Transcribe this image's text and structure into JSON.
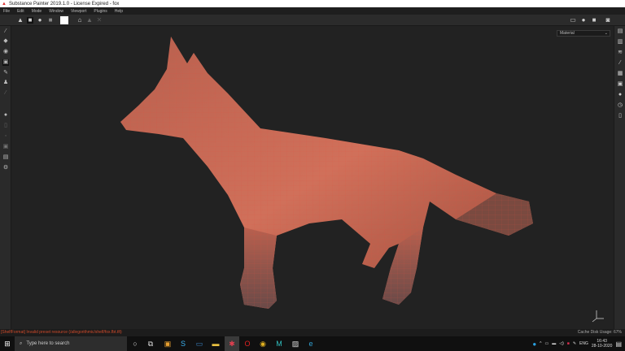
{
  "window": {
    "title": "Substance Painter 2019.1.0 - License Expired - fox"
  },
  "menu": [
    "File",
    "Edit",
    "Mode",
    "Window",
    "Viewport",
    "Plugins",
    "Help"
  ],
  "viewport": {
    "material_mode": "Material"
  },
  "status": {
    "error": "[ShelfFormat] Invalid preset resource (/allegorithmic/shelf/fox.fbt.tft)",
    "cache": "Cache Disk Usage: 67%"
  },
  "taskbar": {
    "search_placeholder": "Type here to search",
    "language": "ENG",
    "time": "16:43",
    "date": "28-10-2020"
  },
  "colors": {
    "accent": "#d04a2a",
    "viewport_bg": "#222222",
    "fox": "#c8604a"
  }
}
